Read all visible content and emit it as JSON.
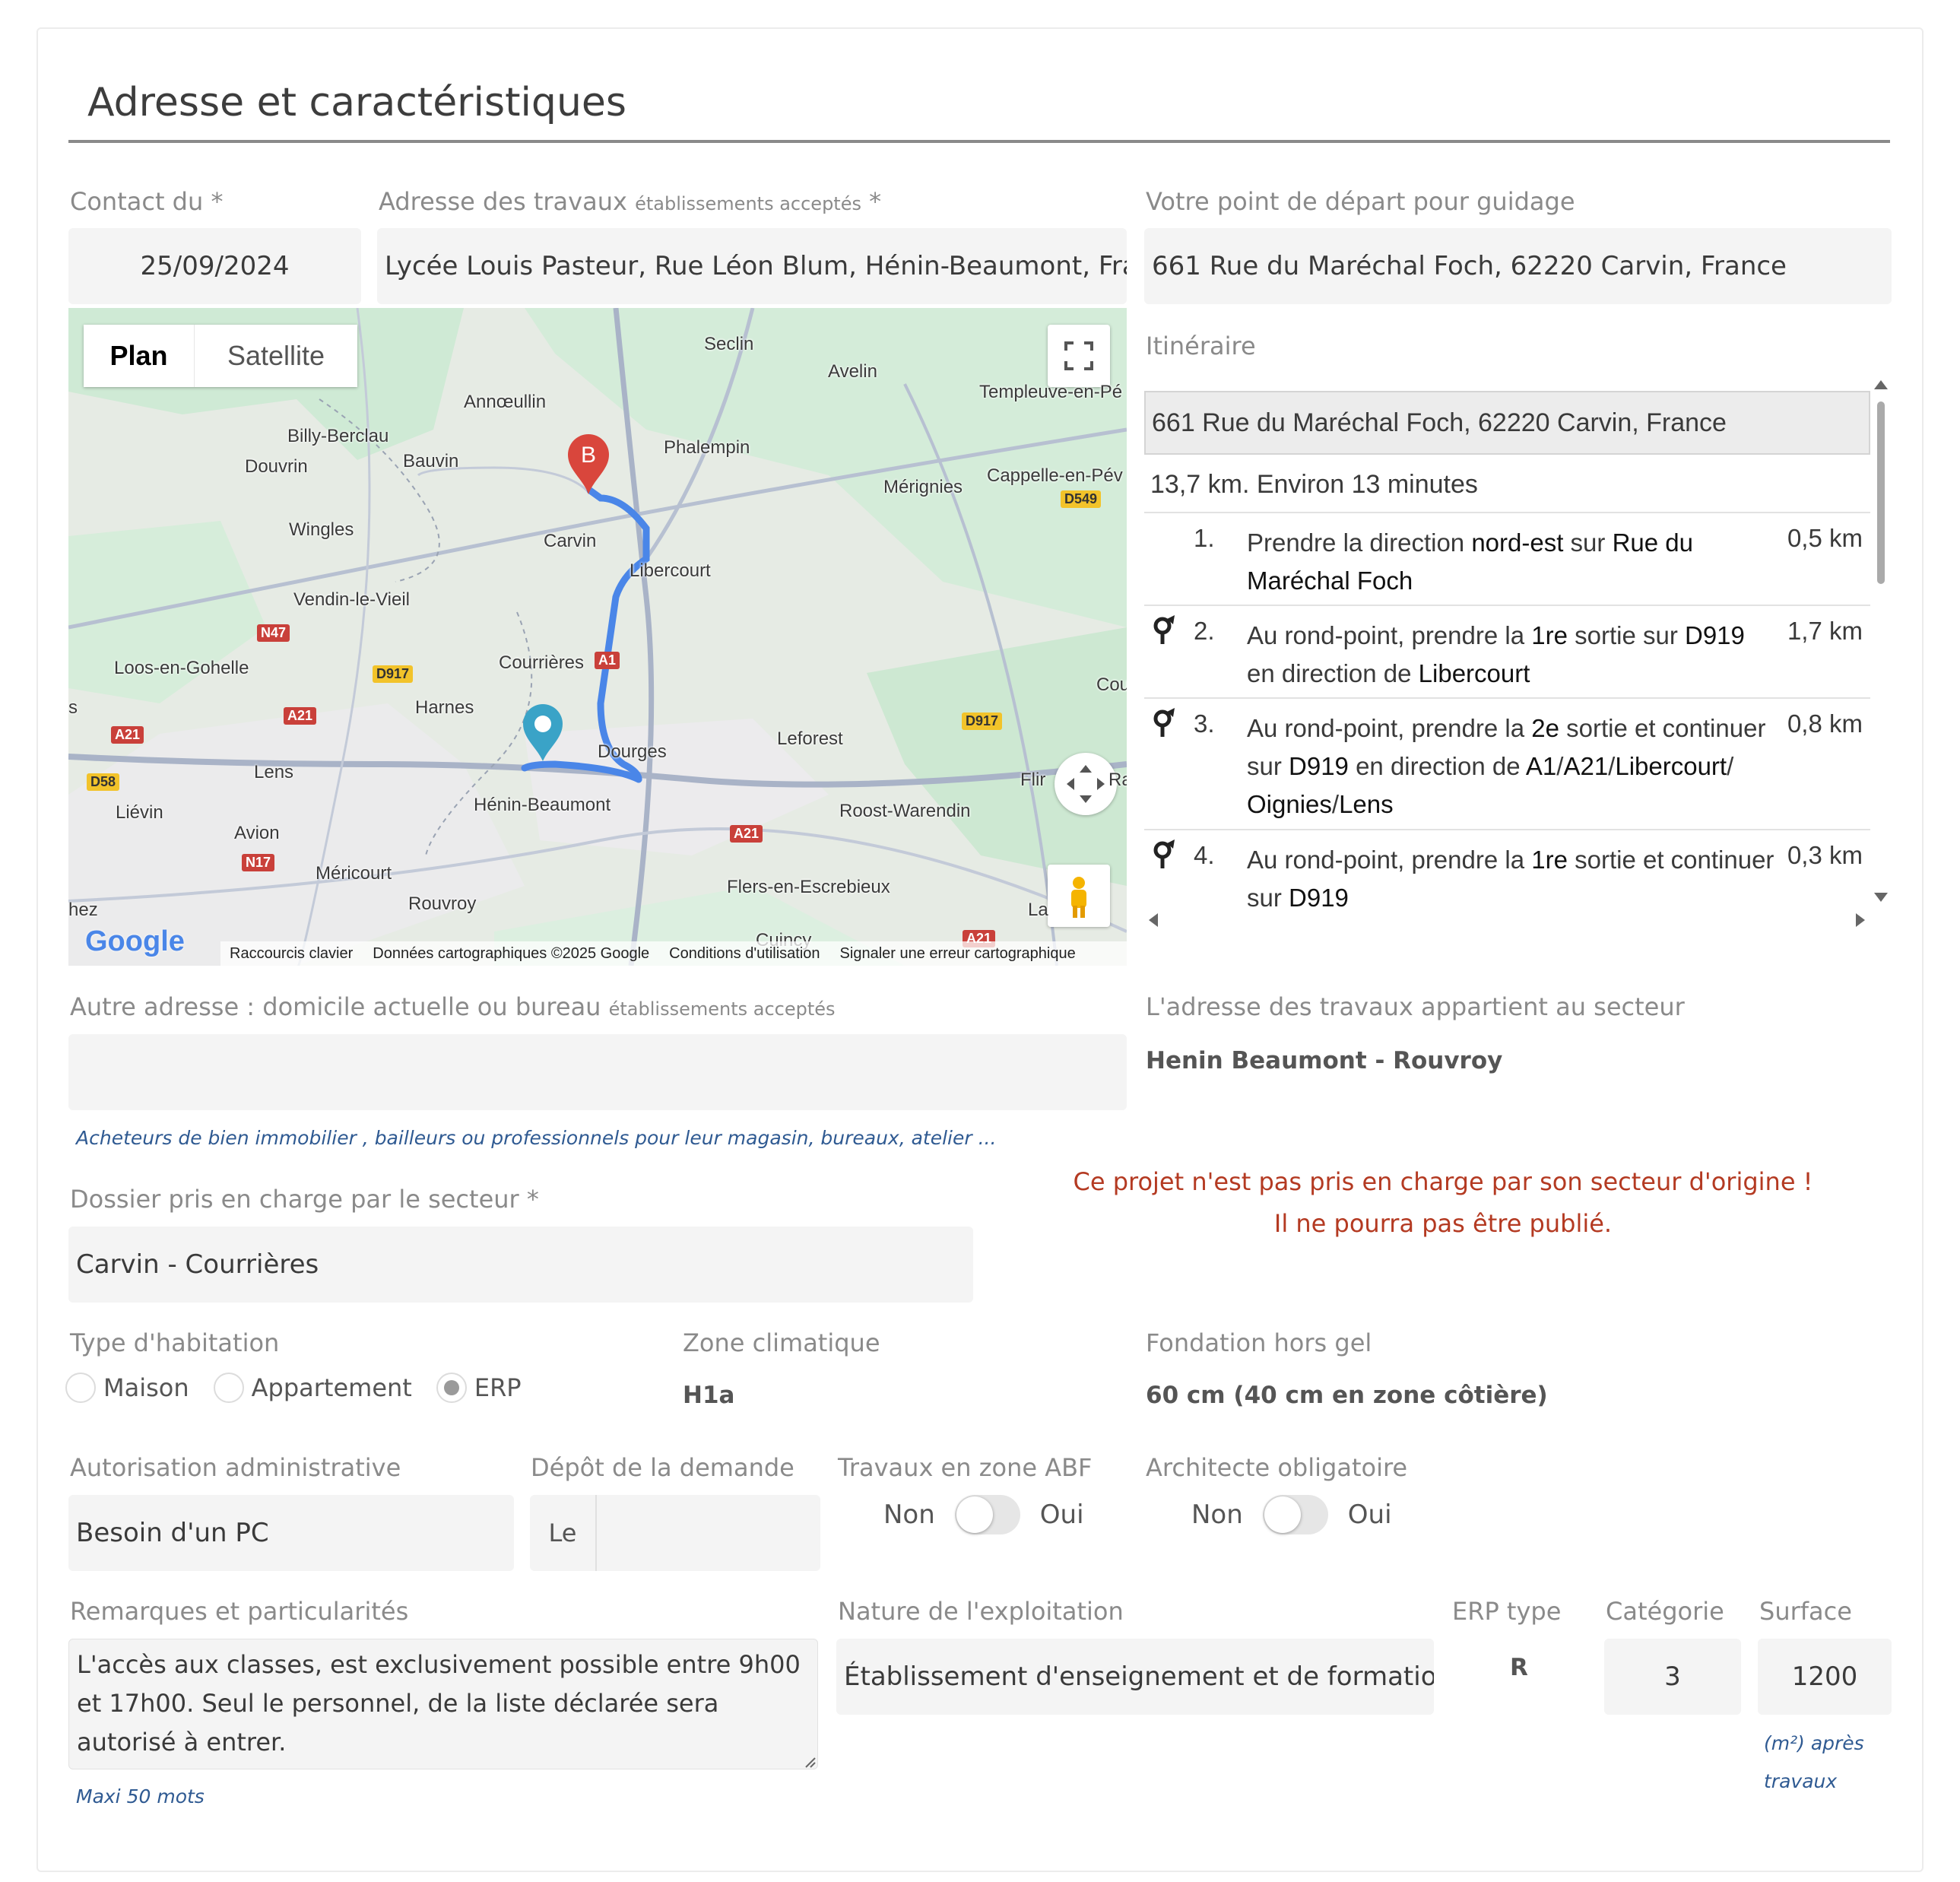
{
  "section_title": "Adresse et caractéristiques",
  "contact": {
    "label": "Contact du *",
    "value": "25/09/2024"
  },
  "address": {
    "label": "Adresse des travaux",
    "label_small": "établissements acceptés",
    "required": "*",
    "value": "Lycée Louis Pasteur, Rue Léon Blum, Hénin-Beaumont, France"
  },
  "departure": {
    "label": "Votre point de départ pour guidage",
    "value": "661 Rue du Maréchal Foch, 62220 Carvin, France"
  },
  "map": {
    "tabs": [
      "Plan",
      "Satellite"
    ],
    "towns": [
      "Seclin",
      "Avelin",
      "Templeuve-en-Pé",
      "Annœullin",
      "Billy-Berclau",
      "Bauvin",
      "Phalempin",
      "Douvrin",
      "Mérignies",
      "Cappelle-en-Pév",
      "Wingles",
      "Carvin",
      "Libercourt",
      "Vendin-le-Vieil",
      "Loos-en-Gohelle",
      "Courrières",
      "Cou",
      "Harnes",
      "Leforest",
      "Dourges",
      "Lens",
      "Flir",
      "Ra",
      "Hénin-Beaumont",
      "Roost-Warendin",
      "Liévin",
      "Avion",
      "Méricourt",
      "Flers-en-Escrebieux",
      "Rouvroy",
      "La",
      "hez",
      "Cuincy",
      "s"
    ],
    "roads": [
      "D549",
      "N47",
      "D917",
      "A1",
      "A21",
      "A21",
      "D917",
      "D58",
      "A21",
      "N17",
      "A21"
    ],
    "marker_b": "B",
    "logo": "Google",
    "attribution": [
      "Raccourcis clavier",
      "Données cartographiques ©2025 Google",
      "Conditions d'utilisation",
      "Signaler une erreur cartographique"
    ]
  },
  "itinerary": {
    "label": "Itinéraire",
    "start": "661 Rue du Maréchal Foch, 62220 Carvin, France",
    "summary": "13,7 km. Environ 13 minutes",
    "steps": [
      {
        "num": "1.",
        "dist": "0,5 km",
        "p": [
          "Prendre la direction ",
          "nord-est",
          " sur ",
          "Rue du Maréchal Foch"
        ]
      },
      {
        "num": "2.",
        "dist": "1,7 km",
        "p": [
          "Au rond-point, prendre la ",
          "1re",
          " sortie sur ",
          "D919",
          " en direction de ",
          "Libercourt"
        ]
      },
      {
        "num": "3.",
        "dist": "0,8 km",
        "p": [
          "Au rond-point, prendre la ",
          "2e",
          " sortie et continuer sur ",
          "D919",
          " en direction de ",
          "A1",
          "/",
          "A21",
          "/",
          "Libercourt",
          "/ ",
          "Oignies",
          "/",
          "Lens"
        ]
      },
      {
        "num": "4.",
        "dist": "0,3 km",
        "p": [
          "Au rond-point, prendre la ",
          "1re",
          " sortie et continuer sur ",
          "D919"
        ]
      }
    ]
  },
  "other_address": {
    "label": "Autre adresse : domicile actuelle ou bureau",
    "label_small": "établissements acceptés",
    "value": "",
    "hint": "Acheteurs de bien immobilier , bailleurs ou professionnels pour leur magasin, bureaux, atelier ..."
  },
  "sector": {
    "label": "L'adresse des travaux appartient au secteur",
    "value": "Henin Beaumont - Rouvroy"
  },
  "warning": {
    "line1": "Ce projet n'est pas pris en charge par son secteur d'origine !",
    "line2": "Il ne pourra pas être publié."
  },
  "handled_by": {
    "label": "Dossier pris en charge par le secteur *",
    "value": "Carvin - Courrières"
  },
  "housing": {
    "label": "Type d'habitation",
    "options": [
      "Maison",
      "Appartement",
      "ERP"
    ],
    "selected": "ERP"
  },
  "climate": {
    "label": "Zone climatique",
    "value": "H1a"
  },
  "foundation": {
    "label": "Fondation hors gel",
    "value": "60 cm (40 cm en zone côtière)"
  },
  "authorization": {
    "label": "Autorisation administrative",
    "value": "Besoin d'un PC"
  },
  "deposit": {
    "label": "Dépôt de la demande",
    "prefix": "Le",
    "value": ""
  },
  "abf": {
    "label": "Travaux en zone ABF",
    "off": "Non",
    "on": "Oui",
    "checked": false
  },
  "architect": {
    "label": "Architecte obligatoire",
    "off": "Non",
    "on": "Oui",
    "checked": false
  },
  "remarks": {
    "label": "Remarques et particularités",
    "value": "L'accès aux classes, est exclusivement possible entre 9h00 et 17h00. Seul le personnel, de la liste déclarée sera autorisé à entrer.",
    "hint": "Maxi 50 mots"
  },
  "nature": {
    "label": "Nature de l'exploitation",
    "value": "Établissement d'enseignement et de formation"
  },
  "erp_type": {
    "label": "ERP type",
    "value": "R"
  },
  "category": {
    "label": "Catégorie",
    "value": "3"
  },
  "surface": {
    "label": "Surface",
    "value": "1200",
    "hint_unit": "(m²) après",
    "hint2": "travaux"
  },
  "colors": {
    "accent_text": "#2f5a92",
    "warning": "#b43a22",
    "route": "#4a86e8",
    "marker_b": "#d9463c",
    "marker_a": "#3aa3c7"
  }
}
